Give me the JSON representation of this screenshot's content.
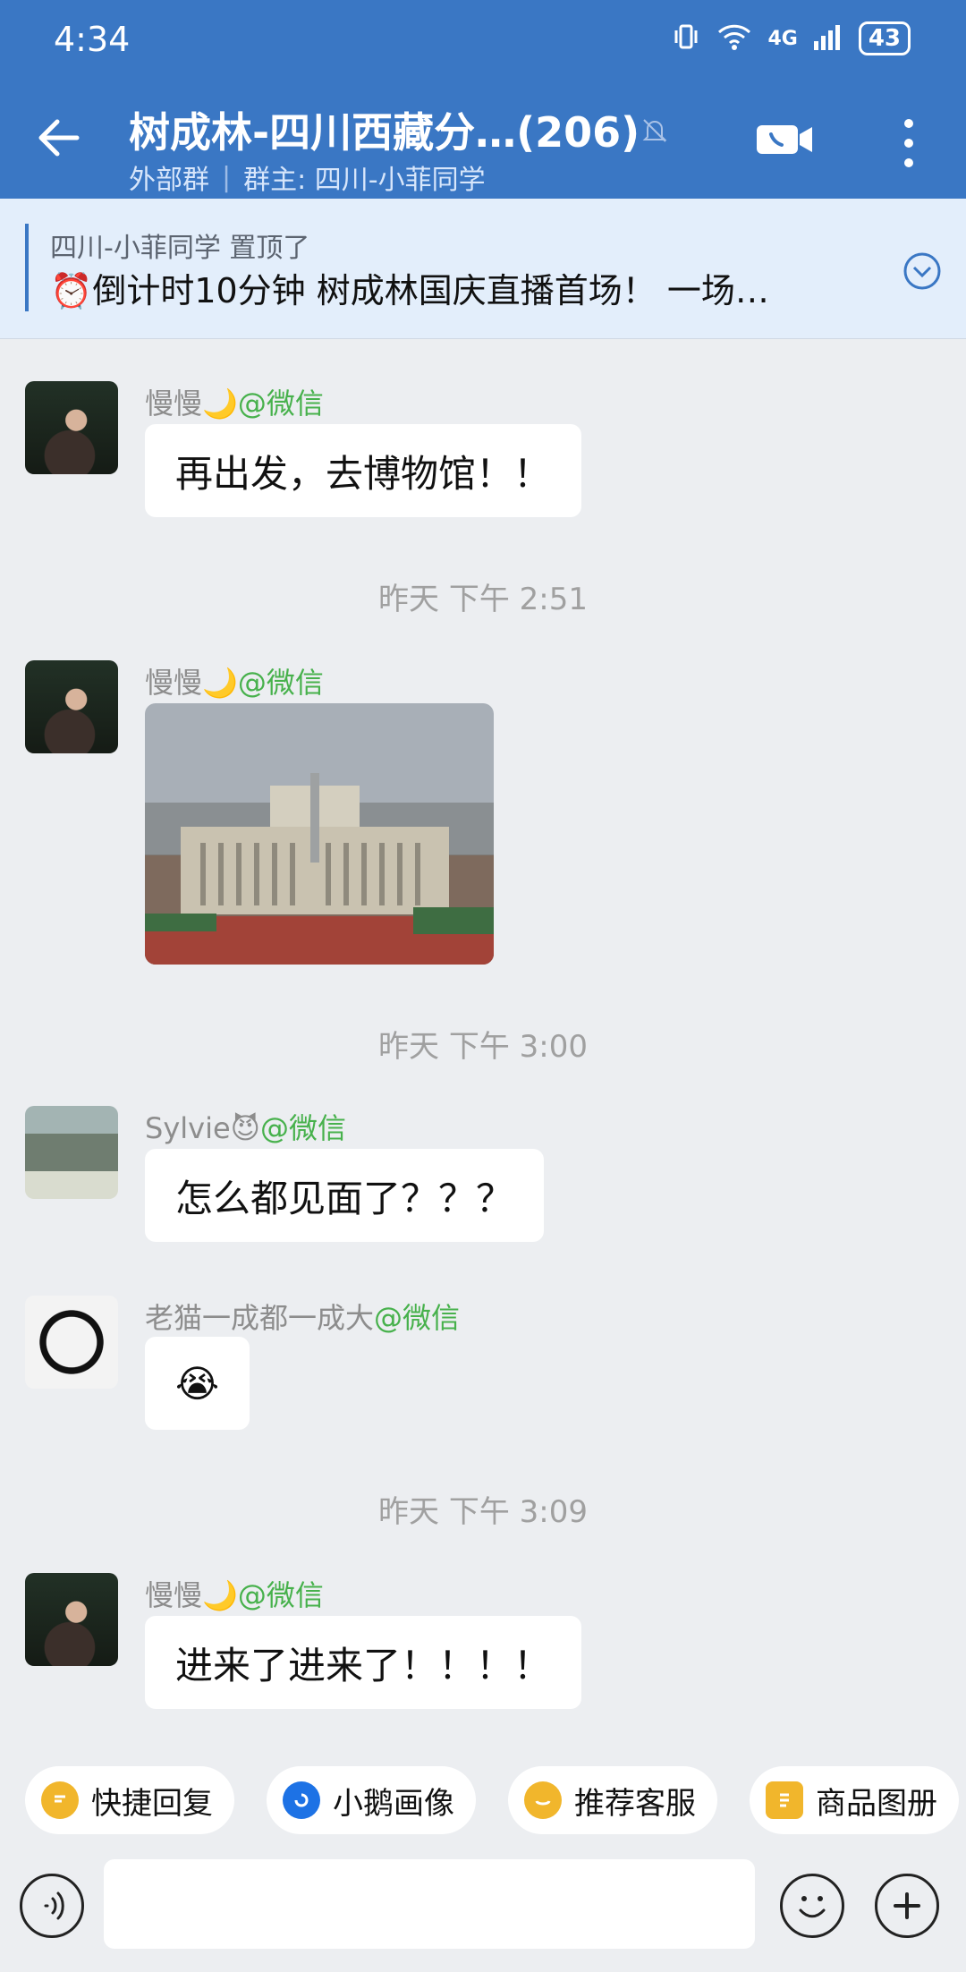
{
  "status": {
    "time": "4:34",
    "network": "4G",
    "battery": "43"
  },
  "header": {
    "title": "树成林-四川西藏分…(206)",
    "group_type": "外部群",
    "owner": "群主: 四川-小菲同学"
  },
  "pinned": {
    "meta": "四川-小菲同学 置顶了",
    "text": "⏰倒计时10分钟 树成林国庆直播首场！ 一场…"
  },
  "messages": [
    {
      "sender": "慢慢🌙",
      "channel": "@微信",
      "text": "再出发，去博物馆！！"
    },
    {
      "timestamp": "昨天 下午 2:51"
    },
    {
      "sender": "慢慢🌙",
      "channel": "@微信",
      "type": "image"
    },
    {
      "timestamp": "昨天 下午 3:00"
    },
    {
      "sender": "Sylvie😈",
      "channel": "@微信",
      "text": "怎么都见面了？？？"
    },
    {
      "sender": "老猫一成都一成大",
      "channel": "@微信",
      "text": "😭"
    },
    {
      "timestamp": "昨天 下午 3:09"
    },
    {
      "sender": "慢慢🌙",
      "channel": "@微信",
      "text": "进来了进来了！！！！"
    }
  ],
  "quick_actions": [
    {
      "label": "快捷回复",
      "icon": "reply-chip-icon",
      "color": "#f1b62c"
    },
    {
      "label": "小鹅画像",
      "icon": "goose-chip-icon",
      "color": "#1d72e5"
    },
    {
      "label": "推荐客服",
      "icon": "service-chip-icon",
      "color": "#f1b62c"
    },
    {
      "label": "商品图册",
      "icon": "catalog-chip-icon",
      "color": "#f1b62c"
    }
  ],
  "input": {
    "placeholder": ""
  },
  "colors": {
    "header": "#3a77c4",
    "pin_bg": "#e3eefb",
    "channel": "#47b14c"
  }
}
